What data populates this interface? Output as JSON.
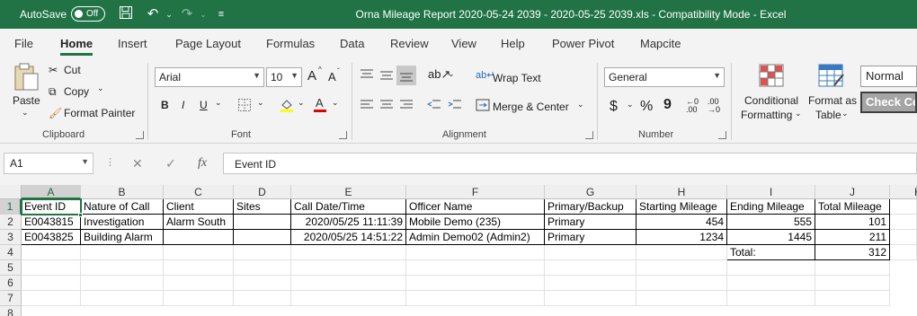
{
  "titlebar": {
    "autosave_label": "AutoSave",
    "autosave_state": "Off",
    "title": "Orna Mileage Report 2020-05-24 2039 - 2020-05-25 2039.xls  -  Compatibility Mode  -  Excel"
  },
  "tabs": [
    "File",
    "Home",
    "Insert",
    "Page Layout",
    "Formulas",
    "Data",
    "Review",
    "View",
    "Help",
    "Power Pivot",
    "Mapcite"
  ],
  "active_tab": "Home",
  "ribbon": {
    "clipboard": {
      "paste": "Paste",
      "cut": "Cut",
      "copy": "Copy",
      "format_painter": "Format Painter",
      "label": "Clipboard"
    },
    "font": {
      "name": "Arial",
      "size": "10",
      "grow": "A",
      "shrink": "A",
      "bold": "B",
      "italic": "I",
      "underline": "U",
      "label": "Font"
    },
    "alignment": {
      "wrap_text": "Wrap Text",
      "merge_center": "Merge & Center",
      "label": "Alignment"
    },
    "number": {
      "format": "General",
      "currency": "$",
      "percent": "%",
      "comma": "9",
      "label": "Number"
    },
    "styles": {
      "conditional": "Conditional",
      "formatting": "Formatting",
      "format_as": "Format as",
      "table": "Table",
      "normal": "Normal",
      "check_cell": "Check Ce"
    }
  },
  "formula_bar": {
    "name_box": "A1",
    "fx": "fx",
    "content": "Event ID"
  },
  "sheet": {
    "columns": [
      "A",
      "B",
      "C",
      "D",
      "E",
      "F",
      "G",
      "H",
      "I",
      "J",
      "K"
    ],
    "rows": [
      "1",
      "2",
      "3",
      "4",
      "5",
      "6",
      "7",
      "8"
    ],
    "header": [
      "Event ID",
      "Nature of Call",
      "Client",
      "Sites",
      "Call Date/Time",
      "Officer Name",
      "Primary/Backup",
      "Starting Mileage",
      "Ending Mileage",
      "Total Mileage"
    ],
    "data": [
      [
        "E0043815",
        "Investigation",
        "Alarm South",
        "",
        "2020/05/25 11:11:39",
        "Mobile Demo (235)",
        "Primary",
        "454",
        "555",
        "101"
      ],
      [
        "E0043825",
        "Building Alarm",
        "",
        "",
        "2020/05/25 14:51:22",
        "Admin Demo02 (Admin2)",
        "Primary",
        "1234",
        "1445",
        "211"
      ]
    ],
    "total_label": "Total:",
    "total_value": "312"
  },
  "colors": {
    "excel_green": "#217346"
  }
}
